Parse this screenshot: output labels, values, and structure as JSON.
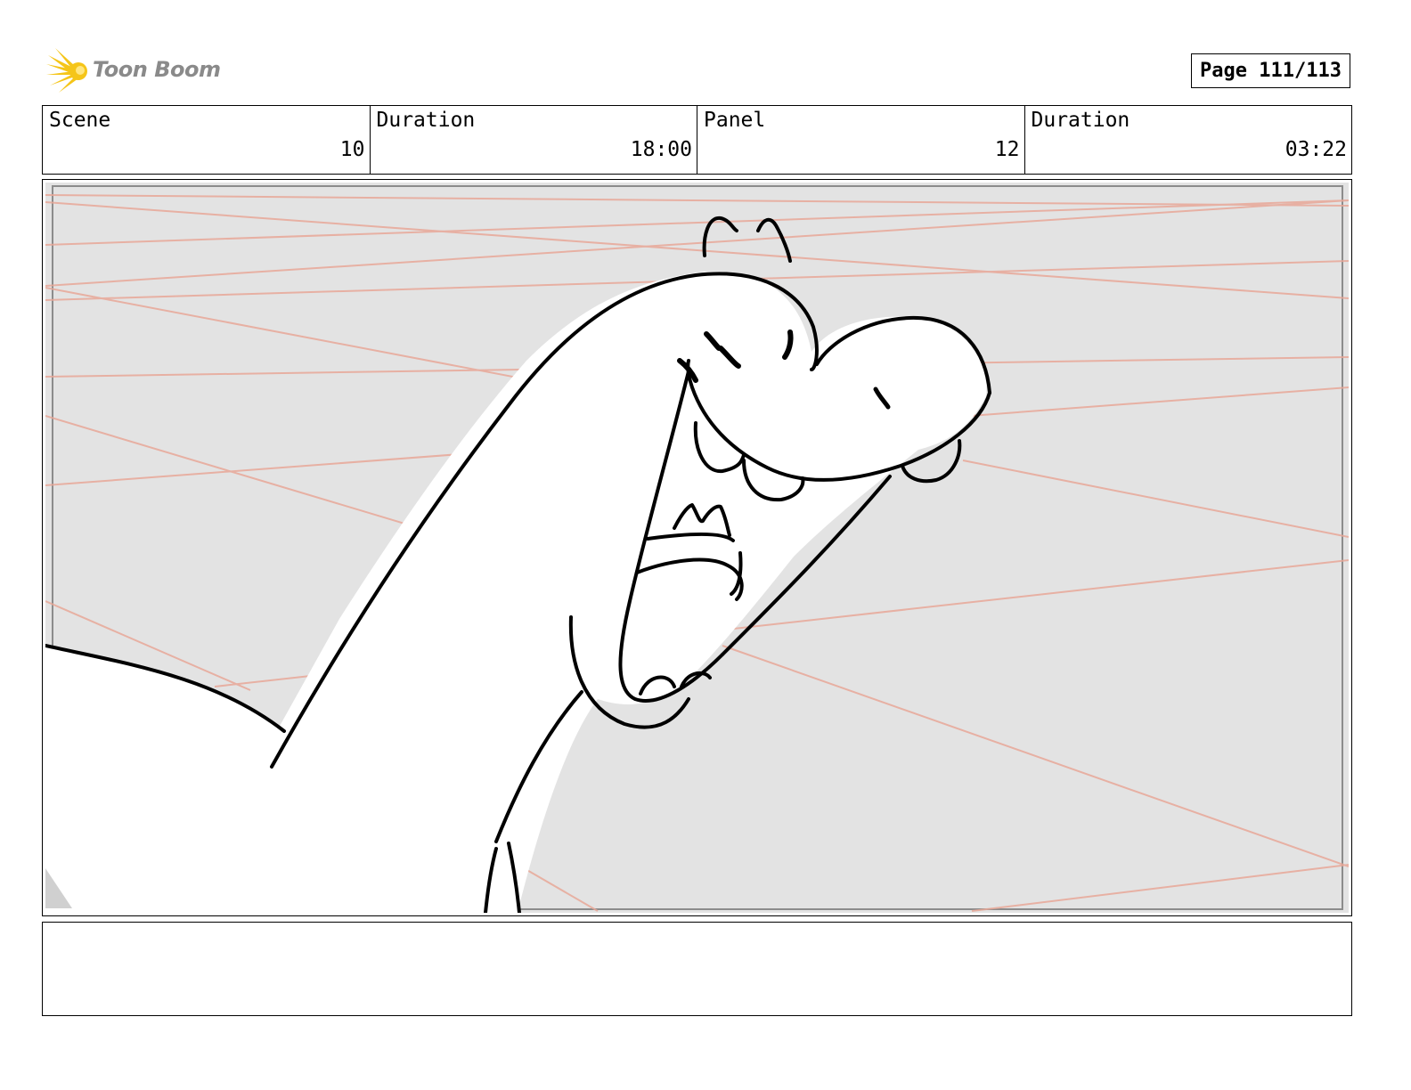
{
  "header": {
    "logo_text": "Toon Boom",
    "page_label": "Page 111/113"
  },
  "info": {
    "scene_label": "Scene",
    "scene_value": "10",
    "scene_duration_label": "Duration",
    "scene_duration_value": "18:00",
    "panel_label": "Panel",
    "panel_value": "12",
    "panel_duration_label": "Duration",
    "panel_duration_value": "03:22"
  },
  "colors": {
    "logo_star": "#f5c518",
    "perspective_lines": "#e8a898",
    "panel_bg": "#e3e3e3"
  },
  "notes": {
    "text": ""
  }
}
